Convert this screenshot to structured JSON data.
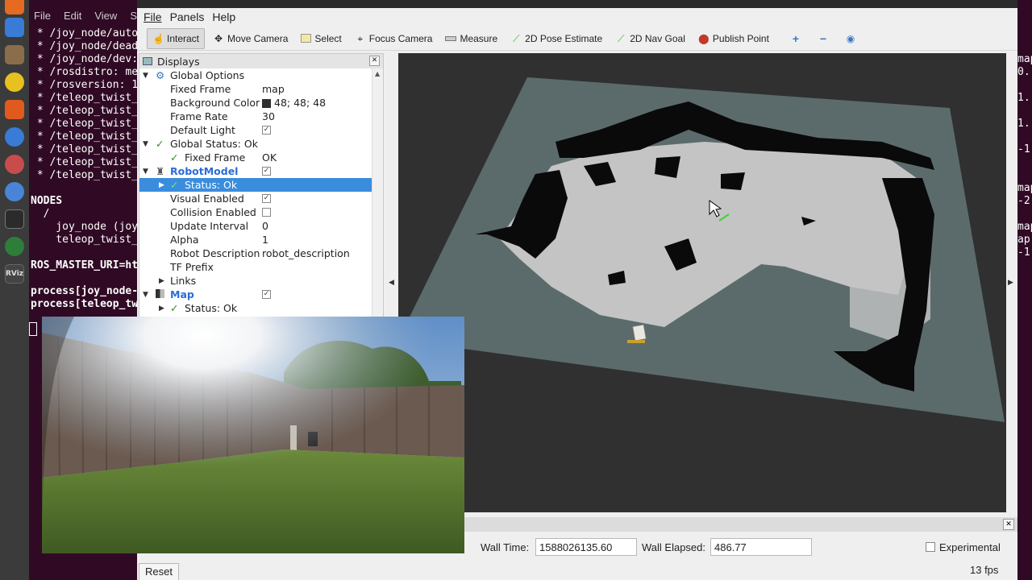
{
  "terminal": {
    "menu": [
      "File",
      "Edit",
      "View",
      "Sea"
    ],
    "lines": [
      " * /joy_node/auto",
      " * /joy_node/dead",
      " * /joy_node/dev:",
      " * /rosdistro: me",
      " * /rosversion: 1",
      " * /teleop_twist_",
      " * /teleop_twist_",
      " * /teleop_twist_",
      " * /teleop_twist_",
      " * /teleop_twist_",
      " * /teleop_twist_",
      " * /teleop_twist_",
      "",
      "NODES",
      "  /",
      "    joy_node (joy",
      "    teleop_twist_",
      "",
      "ROS_MASTER_URI=ht",
      "",
      "process[joy_node-",
      "process[teleop_tw"
    ],
    "right_lines": [
      "map",
      "0.",
      "",
      "1.",
      "",
      "1.",
      "",
      "-1",
      "",
      "",
      "map",
      "-2",
      "",
      "map",
      "ap",
      "-1"
    ]
  },
  "menubar": {
    "file": "File",
    "panels": "Panels",
    "help": "Help"
  },
  "toolbar": {
    "interact": "Interact",
    "move_camera": "Move Camera",
    "select": "Select",
    "focus_camera": "Focus Camera",
    "measure": "Measure",
    "pose_estimate": "2D Pose Estimate",
    "nav_goal": "2D Nav Goal",
    "publish_point": "Publish Point"
  },
  "displays": {
    "title": "Displays",
    "rows": {
      "global_options": "Global Options",
      "fixed_frame": "Fixed Frame",
      "fixed_frame_val": "map",
      "background_color": "Background Color",
      "background_color_val": "48; 48; 48",
      "frame_rate": "Frame Rate",
      "frame_rate_val": "30",
      "default_light": "Default Light",
      "global_status": "Global Status: Ok",
      "gs_fixed_frame": "Fixed Frame",
      "gs_fixed_frame_val": "OK",
      "robot_model": "RobotModel",
      "rm_status": "Status: Ok",
      "visual_enabled": "Visual Enabled",
      "collision_enabled": "Collision Enabled",
      "update_interval": "Update Interval",
      "update_interval_val": "0",
      "alpha": "Alpha",
      "alpha_val": "1",
      "robot_description": "Robot Description",
      "robot_description_val": "robot_description",
      "tf_prefix": "TF Prefix",
      "links": "Links",
      "map": "Map",
      "map_status": "Status: Ok"
    }
  },
  "timepanel": {
    "wall_time_label": "Wall Time:",
    "wall_time_val": "1588026135.60",
    "wall_elapsed_label": "Wall Elapsed:",
    "wall_elapsed_val": "486.77",
    "experimental_label": "Experimental",
    "reset": "Reset",
    "fps": "13 fps"
  },
  "colors": {
    "background": "#303030",
    "map_plane": "#5b6b6b",
    "free_space": "#c4c4c4",
    "occupied": "#0a0a0a",
    "selected": "#3a8ddd"
  }
}
